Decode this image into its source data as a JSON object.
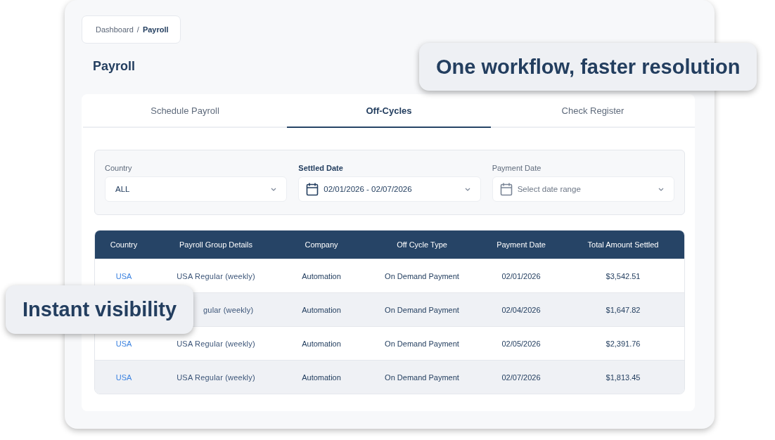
{
  "breadcrumb": {
    "items": [
      "Dashboard"
    ],
    "separator": "/",
    "current": "Payroll"
  },
  "title": "Payroll",
  "tabs": [
    {
      "label": "Schedule Payroll",
      "selected": false
    },
    {
      "label": "Off-Cycles",
      "selected": true
    },
    {
      "label": "Check Register",
      "selected": false
    }
  ],
  "filters": [
    {
      "label": "Country",
      "value": "ALL",
      "active": false
    },
    {
      "label": "Settled Date",
      "value": "02/01/2026 - 02/07/2026",
      "active": true,
      "icon": true
    },
    {
      "label": "Payment Date",
      "placeholder": "Select date range",
      "active": false,
      "icon": true
    }
  ],
  "table": {
    "columns": [
      "Country",
      "Payroll Group Details",
      "Company",
      "Off Cycle Type",
      "Payment Date",
      "Total Amount Settled"
    ],
    "rows": [
      {
        "country": "USA",
        "group": "USA Regular (weekly)",
        "company": "Automation",
        "type": "On Demand Payment",
        "date": "02/01/2026",
        "amount": "$3,542.51"
      },
      {
        "group": "gular (weekly)",
        "company": "Automation",
        "type": "On Demand Payment",
        "date": "02/04/2026",
        "amount": "$1,647.82"
      },
      {
        "country": "USA",
        "group": "USA Regular (weekly)",
        "company": "Automation",
        "type": "On Demand Payment",
        "date": "02/05/2026",
        "amount": "$2,391.76"
      },
      {
        "country": "USA",
        "group": "USA Regular (weekly)",
        "company": "Automation",
        "type": "On Demand Payment",
        "date": "02/07/2026",
        "amount": "$1,813.45"
      }
    ]
  },
  "callouts": [
    {
      "text": "One workflow, faster resolution",
      "kind": "top"
    },
    {
      "text": "Instant visibility",
      "kind": "left"
    }
  ]
}
